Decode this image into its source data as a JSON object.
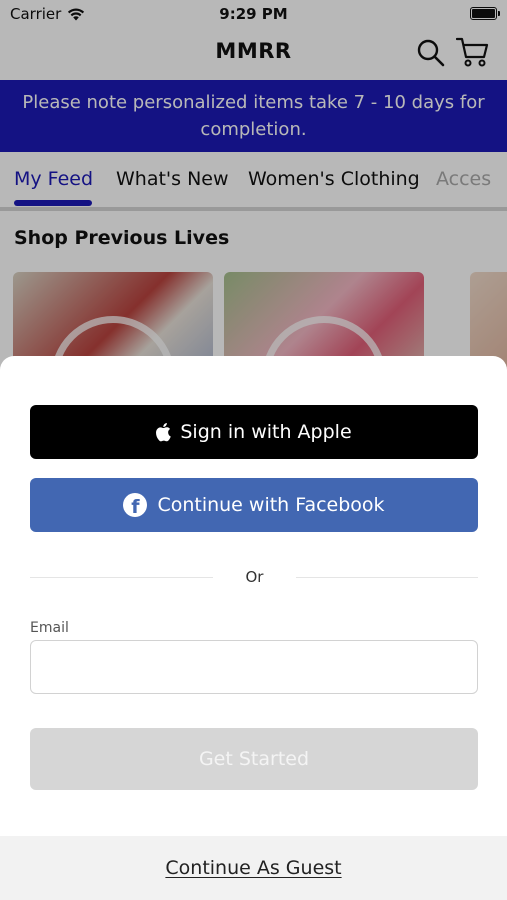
{
  "status_bar": {
    "carrier": "Carrier",
    "time": "9:29 PM",
    "icons": [
      "wifi-icon",
      "battery-icon"
    ]
  },
  "nav": {
    "title": "MMRR",
    "icons": [
      "search-icon",
      "cart-icon"
    ]
  },
  "banner": {
    "text": "Please note personalized items take 7 - 10 days for completion.",
    "background": "#1c1ab6"
  },
  "tabs": [
    {
      "label": "My Feed",
      "active": true
    },
    {
      "label": "What's New",
      "active": false
    },
    {
      "label": "Women's Clothing",
      "active": false
    },
    {
      "label": "Acces",
      "active": false
    }
  ],
  "section": {
    "title": "Shop Previous Lives"
  },
  "sheet": {
    "apple_label": "Sign in with Apple",
    "apple_icon": "apple-logo-icon",
    "facebook_label": "Continue with Facebook",
    "facebook_icon": "facebook-logo-icon",
    "or_text": "Or",
    "email_label": "Email",
    "email_value": "",
    "email_placeholder": "",
    "get_started_label": "Get Started",
    "guest_label": "Continue As Guest"
  },
  "colors": {
    "accent": "#1c1ab6",
    "facebook": "#4267b2",
    "apple": "#000000",
    "disabled_button": "#d6d6d6"
  }
}
